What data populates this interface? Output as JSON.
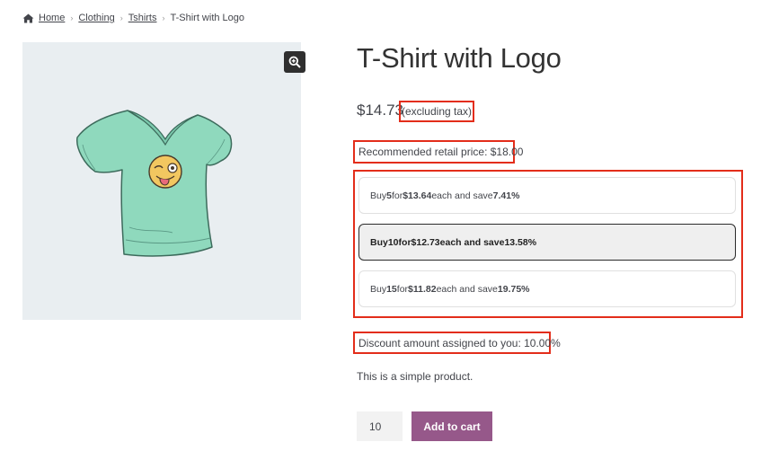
{
  "breadcrumb": {
    "home": "Home",
    "clothing": "Clothing",
    "tshirts": "Tshirts",
    "current": "T-Shirt with Logo"
  },
  "product": {
    "title": "T-Shirt with Logo",
    "price": "$14.73",
    "tax_note": "(excluding tax)",
    "rrp": "Recommended retail price: $18.00",
    "description": "This is a simple product."
  },
  "tiers": [
    {
      "pre1": "Buy ",
      "qty": "5",
      "pre2": " for ",
      "price": "$13.64",
      "pre3": " each and save ",
      "save": "7.41%",
      "selected": false
    },
    {
      "pre1": "Buy ",
      "qty": "10",
      "pre2": " for ",
      "price": "$12.73",
      "pre3": " each and save ",
      "save": "13.58%",
      "selected": true
    },
    {
      "pre1": "Buy ",
      "qty": "15",
      "pre2": " for ",
      "price": "$11.82",
      "pre3": " each and save ",
      "save": "19.75%",
      "selected": false
    }
  ],
  "discount": "Discount amount assigned to you: 10.00%",
  "cart": {
    "quantity": "10",
    "add_label": "Add to cart"
  },
  "colors": {
    "accent": "#96588a",
    "highlight": "#e32d1a",
    "gallery_bg": "#e9eef1"
  },
  "icons": {
    "home": "home-icon",
    "zoom": "zoom-in-icon"
  }
}
